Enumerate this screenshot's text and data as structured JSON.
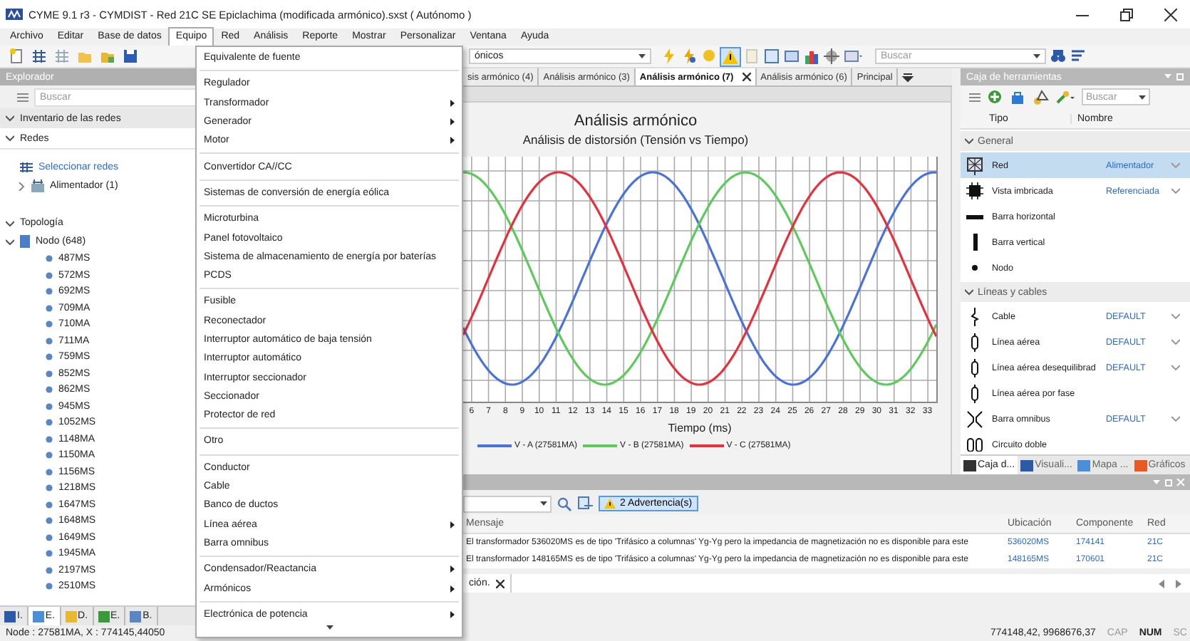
{
  "window": {
    "title": "CYME 9.1 r3 - CYMDIST - Red 21C SE Epiclachima (modificada armónico).sxst ( Autónomo )"
  },
  "menubar": [
    {
      "label": "Archivo",
      "selected": false
    },
    {
      "label": "Editar",
      "selected": false
    },
    {
      "label": "Base de datos",
      "selected": false
    },
    {
      "label": "Equipo",
      "selected": true
    },
    {
      "label": "Red",
      "selected": false
    },
    {
      "label": "Análisis",
      "selected": false
    },
    {
      "label": "Reporte",
      "selected": false
    },
    {
      "label": "Mostrar",
      "selected": false
    },
    {
      "label": "Personalizar",
      "selected": false
    },
    {
      "label": "Ventana",
      "selected": false
    },
    {
      "label": "Ayuda",
      "selected": false
    }
  ],
  "toolbar": {
    "study_combo_value": "ónicos",
    "search_placeholder": "Buscar"
  },
  "explorer": {
    "title": "Explorador",
    "search_placeholder": "Buscar",
    "inventory": {
      "label": "Inventario de las redes",
      "expanded": true
    },
    "networks": {
      "label": "Redes",
      "expanded": true,
      "select_link": "Seleccionar redes",
      "feeder": {
        "label": "Alimentador (1)",
        "expanded": false
      }
    },
    "topology": {
      "label": "Topología",
      "expanded": true,
      "node": {
        "label": "Nodo (648)",
        "expanded": true,
        "children": [
          {
            "label": "487MS"
          },
          {
            "label": "572MS"
          },
          {
            "label": "692MS"
          },
          {
            "label": "709MA"
          },
          {
            "label": "710MA"
          },
          {
            "label": "711MA"
          },
          {
            "label": "759MS"
          },
          {
            "label": "852MS"
          },
          {
            "label": "862MS"
          },
          {
            "label": "945MS"
          },
          {
            "label": "1052MS"
          },
          {
            "label": "1148MA"
          },
          {
            "label": "1150MA"
          },
          {
            "label": "1156MS"
          },
          {
            "label": "1218MS"
          },
          {
            "label": "1647MS"
          },
          {
            "label": "1648MS"
          },
          {
            "label": "1649MS"
          },
          {
            "label": "1945MA"
          },
          {
            "label": "2197MS"
          },
          {
            "label": "2510MS"
          }
        ]
      }
    },
    "bottom_tabs": [
      {
        "label": "I.",
        "selected": false
      },
      {
        "label": "E.",
        "selected": true
      },
      {
        "label": "D.",
        "selected": false
      },
      {
        "label": "E.",
        "selected": false
      },
      {
        "label": "B.",
        "selected": false
      }
    ]
  },
  "equipo_menu": {
    "groups": [
      {
        "items": [
          {
            "label": "Equivalente de fuente",
            "submenu": false
          }
        ]
      },
      {
        "items": [
          {
            "label": "Regulador",
            "submenu": false
          },
          {
            "label": "Transformador",
            "submenu": true
          },
          {
            "label": "Generador",
            "submenu": true
          },
          {
            "label": "Motor",
            "submenu": true
          }
        ]
      },
      {
        "items": [
          {
            "label": "Convertidor CA//CC",
            "submenu": false
          }
        ]
      },
      {
        "items": [
          {
            "label": "Sistemas de conversión de energía eólica",
            "submenu": false
          }
        ]
      },
      {
        "items": [
          {
            "label": "Microturbina",
            "submenu": false
          },
          {
            "label": "Panel fotovoltaico",
            "submenu": false
          },
          {
            "label": "Sistema de almacenamiento de energía por baterías",
            "submenu": false
          },
          {
            "label": "PCDS",
            "submenu": false
          }
        ]
      },
      {
        "items": [
          {
            "label": "Fusible",
            "submenu": false
          },
          {
            "label": "Reconectador",
            "submenu": false
          },
          {
            "label": "Interruptor automático de baja tensión",
            "submenu": false
          },
          {
            "label": "Interruptor automático",
            "submenu": false
          },
          {
            "label": "Interruptor seccionador",
            "submenu": false
          },
          {
            "label": "Seccionador",
            "submenu": false
          },
          {
            "label": "Protector de red",
            "submenu": false
          }
        ]
      },
      {
        "items": [
          {
            "label": "Otro",
            "submenu": false
          }
        ]
      },
      {
        "items": [
          {
            "label": "Conductor",
            "submenu": false
          },
          {
            "label": "Cable",
            "submenu": false
          },
          {
            "label": "Banco de ductos",
            "submenu": false
          },
          {
            "label": "Línea aérea",
            "submenu": true
          },
          {
            "label": "Barra omnibus",
            "submenu": false
          }
        ]
      },
      {
        "items": [
          {
            "label": "Condensador/Reactancia",
            "submenu": true
          },
          {
            "label": "Armónicos",
            "submenu": true
          }
        ]
      },
      {
        "items": [
          {
            "label": "Electrónica de potencia",
            "submenu": true
          }
        ]
      }
    ]
  },
  "document_tabs": [
    {
      "label": "sis armónico (4)",
      "selected": false
    },
    {
      "label": "Análisis armónico (3)",
      "selected": false
    },
    {
      "label": "Análisis armónico (7)",
      "selected": true
    },
    {
      "label": "Análisis armónico (6)",
      "selected": false
    },
    {
      "label": "Principal",
      "selected": false
    }
  ],
  "chart": {
    "title": "Análisis armónico",
    "subtitle": "Análisis de distorsión (Tensión vs Tiempo)",
    "xlabel": "Tiempo (ms)",
    "x_tick_labels": [
      "6",
      "7",
      "8",
      "9",
      "10",
      "11",
      "12",
      "13",
      "14",
      "15",
      "16",
      "17",
      "18",
      "19",
      "20",
      "21",
      "22",
      "23",
      "24",
      "25",
      "26",
      "27",
      "28",
      "29",
      "30",
      "31",
      "32",
      "33"
    ],
    "legend": [
      {
        "label": "V - A (27581MA)",
        "color": "#4a72dc"
      },
      {
        "label": "V - B (27581MA)",
        "color": "#5ccb5c"
      },
      {
        "label": "V - C (27581MA)",
        "color": "#e8303c"
      }
    ]
  },
  "toolbox": {
    "title": "Caja de herramientas",
    "search_placeholder": "Buscar",
    "columns": [
      "Tipo",
      "Nombre"
    ],
    "groups": [
      {
        "label": "General",
        "expanded": true,
        "items": [
          {
            "kind": "network",
            "label": "Red",
            "name": "Alimentador",
            "selected": true
          },
          {
            "kind": "chip",
            "label": "Vista imbricada",
            "name": "Referenciada",
            "selected": false
          },
          {
            "kind": "hbar",
            "label": "Barra horizontal",
            "selected": false
          },
          {
            "kind": "vbar",
            "label": "Barra vertical",
            "selected": false
          },
          {
            "kind": "node",
            "label": "Nodo",
            "selected": false
          }
        ]
      },
      {
        "label": "Líneas y cables",
        "expanded": true,
        "items": [
          {
            "kind": "cable",
            "label": "Cable",
            "name": "DEFAULT",
            "selected": false
          },
          {
            "kind": "line",
            "label": "Línea aérea",
            "name": "DEFAULT",
            "selected": false
          },
          {
            "kind": "line",
            "label": "Línea aérea desequilibrad",
            "name": "DEFAULT",
            "selected": false
          },
          {
            "kind": "line",
            "label": "Línea aérea por fase",
            "selected": false
          },
          {
            "kind": "bus",
            "label": "Barra omnibus",
            "name": "DEFAULT",
            "selected": false
          },
          {
            "kind": "double",
            "label": "Circuito doble",
            "selected": false
          }
        ]
      }
    ],
    "bottom_tabs": [
      {
        "label": "Caja d...",
        "selected": true
      },
      {
        "label": "Visuali...",
        "selected": false
      },
      {
        "label": "Mapa ...",
        "selected": false
      },
      {
        "label": "Gráficos",
        "selected": false
      }
    ]
  },
  "messages": {
    "warnings_button": {
      "label": "2 Advertencia(s)",
      "pressed": true
    },
    "columns": [
      "Mensaje",
      "Ubicación",
      "Componente",
      "Red"
    ],
    "rows": [
      {
        "message": "El transformador 536020MS es de tipo 'Trifásico a columnas' Yg-Yg pero la impedancia de magnetización no es disponible para este",
        "location": "536020MS",
        "component": "174141",
        "network": "21C"
      },
      {
        "message": "El transformador 148165MS es de tipo 'Trifásico a columnas' Yg-Yg pero la impedancia de magnetización no es disponible para este",
        "location": "148165MS",
        "component": "170601",
        "network": "21C"
      }
    ],
    "tab": "ción."
  },
  "status_bar": {
    "node_info": "Node : 27581MA, X : 774145,44050",
    "coordinates": "774148,42, 9968676,37",
    "indicators": [
      {
        "label": "CAP",
        "on": false
      },
      {
        "label": "NUM",
        "on": true
      },
      {
        "label": "SC",
        "on": false
      }
    ]
  }
}
